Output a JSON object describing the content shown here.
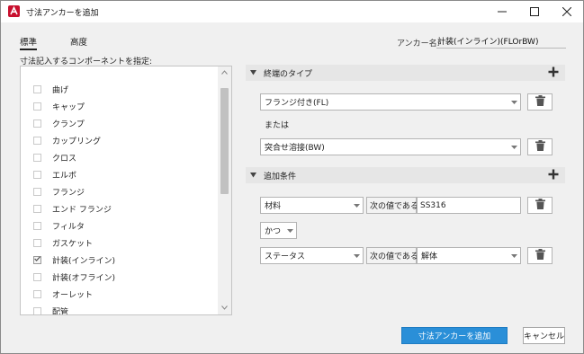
{
  "window": {
    "title": "寸法アンカーを追加",
    "icon": "autocad-plant-icon",
    "controls": {
      "minimize": "minimize-icon",
      "maximize": "maximize-icon",
      "close": "close-icon"
    }
  },
  "tabs": [
    {
      "label": "標準",
      "active": true
    },
    {
      "label": "高度",
      "active": false
    }
  ],
  "anchor_name": {
    "label": "アンカー名:",
    "value": "計装(インライン)(FLOrBW)"
  },
  "components": {
    "label": "寸法記入するコンポーネントを指定:",
    "items": [
      {
        "label": "曲げ",
        "checked": false
      },
      {
        "label": "キャップ",
        "checked": false
      },
      {
        "label": "クランプ",
        "checked": false
      },
      {
        "label": "カップリング",
        "checked": false
      },
      {
        "label": "クロス",
        "checked": false
      },
      {
        "label": "エルボ",
        "checked": false
      },
      {
        "label": "フランジ",
        "checked": false
      },
      {
        "label": "エンド フランジ",
        "checked": false
      },
      {
        "label": "フィルタ",
        "checked": false
      },
      {
        "label": "ガスケット",
        "checked": false
      },
      {
        "label": "計装(インライン)",
        "checked": true
      },
      {
        "label": "計装(オフライン)",
        "checked": false
      },
      {
        "label": "オーレット",
        "checked": false
      },
      {
        "label": "配管",
        "checked": false
      }
    ]
  },
  "end_type": {
    "title": "終端のタイプ",
    "first": "フランジ付き(FL)",
    "or_label": "または",
    "second": "突合せ溶接(BW)"
  },
  "conditions": {
    "title": "追加条件",
    "rows": [
      {
        "property": "材料",
        "operator": "次の値である",
        "value": "SS316",
        "value_is_dropdown": false
      },
      {
        "property": "ステータス",
        "operator": "次の値である",
        "value": "解体",
        "value_is_dropdown": true
      }
    ],
    "connector": "かつ"
  },
  "footer": {
    "add_label": "寸法アンカーを追加",
    "cancel_label": "キャンセル"
  },
  "colors": {
    "primary": "#2a8fd8",
    "app_icon": "#c8102e",
    "section_header": "#e6e6e6"
  }
}
